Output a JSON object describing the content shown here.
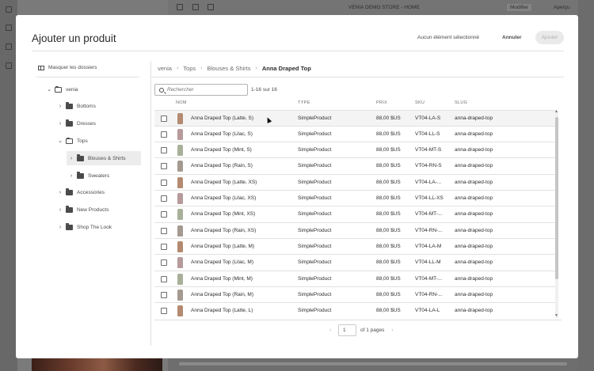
{
  "background": {
    "page_title": "VENIA DEMO STORE - HOME",
    "modifier_label": "Modifier",
    "apercu_label": "Aperçu"
  },
  "dialog": {
    "title": "Ajouter un produit",
    "selection_status": "Aucun élément sélectionné",
    "cancel_label": "Annuler",
    "add_label": "Ajouter"
  },
  "tree": {
    "toggle_label": "Masquer les dossiers",
    "items": [
      {
        "label": "venia",
        "level": 0,
        "expanded": true,
        "selected": false
      },
      {
        "label": "Bottoms",
        "level": 1,
        "expanded": false,
        "selected": false
      },
      {
        "label": "Dresses",
        "level": 1,
        "expanded": false,
        "selected": false
      },
      {
        "label": "Tops",
        "level": 1,
        "expanded": true,
        "selected": false
      },
      {
        "label": "Blouses & Shirts",
        "level": 2,
        "expanded": false,
        "selected": true
      },
      {
        "label": "Sweaters",
        "level": 2,
        "expanded": false,
        "selected": false
      },
      {
        "label": "Accessories",
        "level": 1,
        "expanded": false,
        "selected": false
      },
      {
        "label": "New Products",
        "level": 1,
        "expanded": false,
        "selected": false
      },
      {
        "label": "Shop The Look",
        "level": 1,
        "expanded": false,
        "selected": false
      }
    ]
  },
  "breadcrumb": [
    "venia",
    "Tops",
    "Blouses & Shirts",
    "Anna Draped Top"
  ],
  "search": {
    "placeholder": "Rechercher"
  },
  "result_count": "1-16 sur 16",
  "table": {
    "headers": [
      "NOM",
      "TYPE",
      "PRIX",
      "SKU",
      "SLUG"
    ],
    "rows": [
      {
        "name": "Anna Draped Top (Latte, S)",
        "type": "SimpleProduct",
        "price": "88,00 $US",
        "sku": "VT04-LA-S",
        "slug": "anna-draped-top",
        "color": "#b48a70"
      },
      {
        "name": "Anna Draped Top (Lilac, S)",
        "type": "SimpleProduct",
        "price": "88,00 $US",
        "sku": "VT04-LL-S",
        "slug": "anna-draped-top",
        "color": "#b79a9c"
      },
      {
        "name": "Anna Draped Top (Mint, S)",
        "type": "SimpleProduct",
        "price": "88,00 $US",
        "sku": "VT04-MT-S",
        "slug": "anna-draped-top",
        "color": "#a9b09a"
      },
      {
        "name": "Anna Draped Top (Rain, S)",
        "type": "SimpleProduct",
        "price": "88,00 $US",
        "sku": "VT04-RN-S",
        "slug": "anna-draped-top",
        "color": "#a59a90"
      },
      {
        "name": "Anna Draped Top (Latte, XS)",
        "type": "SimpleProduct",
        "price": "88,00 $US",
        "sku": "VT04-LA-...",
        "slug": "anna-draped-top",
        "color": "#b48a70"
      },
      {
        "name": "Anna Draped Top (Lilac, XS)",
        "type": "SimpleProduct",
        "price": "88,00 $US",
        "sku": "VT04-LL-XS",
        "slug": "anna-draped-top",
        "color": "#b79a9c"
      },
      {
        "name": "Anna Draped Top (Mint, XS)",
        "type": "SimpleProduct",
        "price": "88,00 $US",
        "sku": "VT04-MT-...",
        "slug": "anna-draped-top",
        "color": "#a9b09a"
      },
      {
        "name": "Anna Draped Top (Rain, XS)",
        "type": "SimpleProduct",
        "price": "88,00 $US",
        "sku": "VT04-RN-...",
        "slug": "anna-draped-top",
        "color": "#a59a90"
      },
      {
        "name": "Anna Draped Top (Latte, M)",
        "type": "SimpleProduct",
        "price": "88,00 $US",
        "sku": "VT04-LA-M",
        "slug": "anna-draped-top",
        "color": "#b48a70"
      },
      {
        "name": "Anna Draped Top (Lilac, M)",
        "type": "SimpleProduct",
        "price": "88,00 $US",
        "sku": "VT04-LL-M",
        "slug": "anna-draped-top",
        "color": "#b79a9c"
      },
      {
        "name": "Anna Draped Top (Mint, M)",
        "type": "SimpleProduct",
        "price": "88,00 $US",
        "sku": "VT04-MT-...",
        "slug": "anna-draped-top",
        "color": "#a9b09a"
      },
      {
        "name": "Anna Draped Top (Rain, M)",
        "type": "SimpleProduct",
        "price": "88,00 $US",
        "sku": "VT04-RN-...",
        "slug": "anna-draped-top",
        "color": "#a59a90"
      },
      {
        "name": "Anna Draped Top (Latte, L)",
        "type": "SimpleProduct",
        "price": "88,00 $US",
        "sku": "VT04-LA-L",
        "slug": "anna-draped-top",
        "color": "#b48a70"
      }
    ]
  },
  "pagination": {
    "page": "1",
    "of_pages": "of 1 pages"
  }
}
